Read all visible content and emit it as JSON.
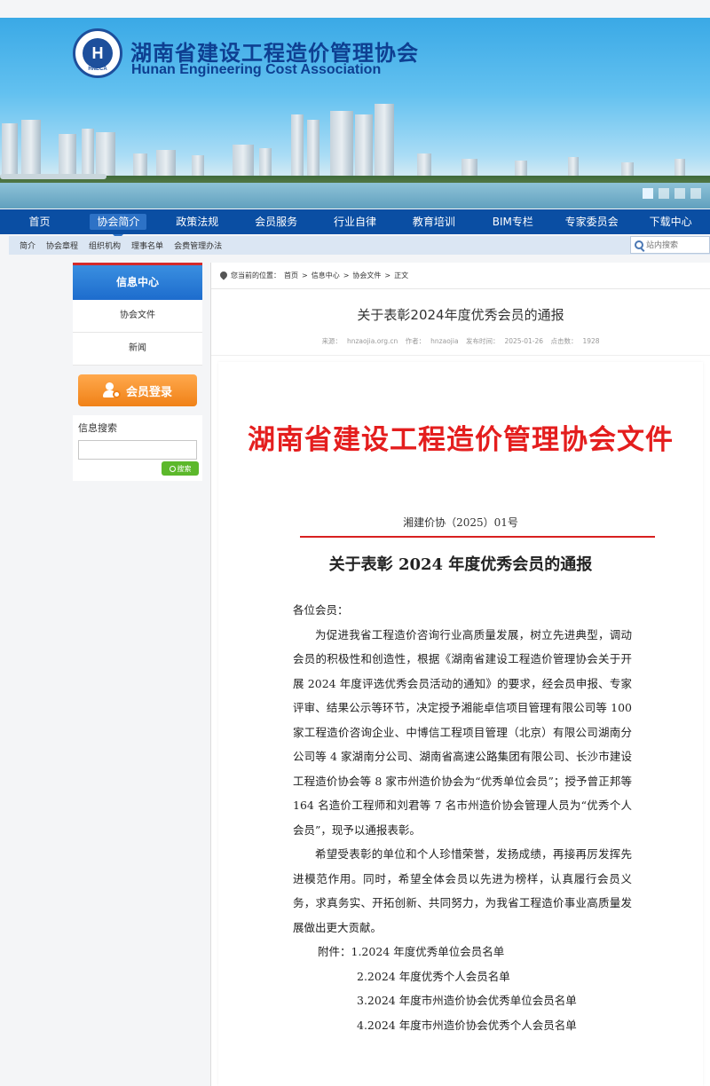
{
  "header": {
    "org_cn": "湖南省建设工程造价管理协会",
    "org_en": "Hunan Engineering Cost Association",
    "logo_letter": "H",
    "logo_ring": "HNECA"
  },
  "nav": {
    "items": [
      {
        "label": "首页",
        "active": false
      },
      {
        "label": "协会简介",
        "active": true
      },
      {
        "label": "政策法规",
        "active": false
      },
      {
        "label": "会员服务",
        "active": false
      },
      {
        "label": "行业自律",
        "active": false
      },
      {
        "label": "教育培训",
        "active": false
      },
      {
        "label": "BIM专栏",
        "active": false
      },
      {
        "label": "专家委员会",
        "active": false
      },
      {
        "label": "下载中心",
        "active": false
      }
    ]
  },
  "subnav": {
    "items": [
      "简介",
      "协会章程",
      "组织机构",
      "理事名单",
      "会费管理办法"
    ],
    "search_placeholder": "站内搜索"
  },
  "sidebar": {
    "title": "信息中心",
    "items": [
      "协会文件",
      "新闻"
    ],
    "login_label": "会员登录",
    "search_title": "信息搜索",
    "search_button": "搜索"
  },
  "breadcrumb": {
    "prefix": "您当前的位置：",
    "items": [
      "首页",
      "信息中心",
      "协会文件",
      "正文"
    ],
    "separator": ">"
  },
  "article": {
    "title": "关于表彰2024年度优秀会员的通报",
    "source_label": "来源：",
    "source": "hnzaojia.org.cn",
    "author_label": "作者：",
    "author": "hnzaojia",
    "date_label": "发布时间：",
    "date": "2025-01-26",
    "views_label": "点击数：",
    "views": "1928"
  },
  "document": {
    "header": "湖南省建设工程造价管理协会文件",
    "number": "湘建价协（2025）01号",
    "title": "关于表彰 2024 年度优秀会员的通报",
    "salutation": "各位会员：",
    "para1": "为促进我省工程造价咨询行业高质量发展，树立先进典型，调动会员的积极性和创造性，根据《湖南省建设工程造价管理协会关于开展 2024 年度评选优秀会员活动的通知》的要求，经会员申报、专家评审、结果公示等环节，决定授予湘能卓信项目管理有限公司等 100 家工程造价咨询企业、中博信工程项目管理（北京）有限公司湖南分公司等 4 家湖南分公司、湖南省高速公路集团有限公司、长沙市建设工程造价协会等 8 家市州造价协会为“优秀单位会员”；授予曾正邦等 164 名造价工程师和刘君等 7 名市州造价协会管理人员为“优秀个人会员”，现予以通报表彰。",
    "para2": "希望受表彰的单位和个人珍惜荣誉，发扬成绩，再接再厉发挥先进模范作用。同时，希望全体会员以先进为榜样，认真履行会员义务，求真务实、开拓创新、共同努力，为我省工程造价事业高质量发展做出更大贡献。",
    "attach1": "附件：1.2024 年度优秀单位会员名单",
    "attach2": "2.2024 年度优秀个人会员名单",
    "attach3": "3.2024 年度市州造价协会优秀单位会员名单",
    "attach4": "4.2024 年度市州造价协会优秀个人会员名单"
  },
  "colors": {
    "nav_bg": "#0a4ea3",
    "doc_red": "#e41e1e",
    "login_orange": "#f08117",
    "search_green": "#5cb82b"
  }
}
